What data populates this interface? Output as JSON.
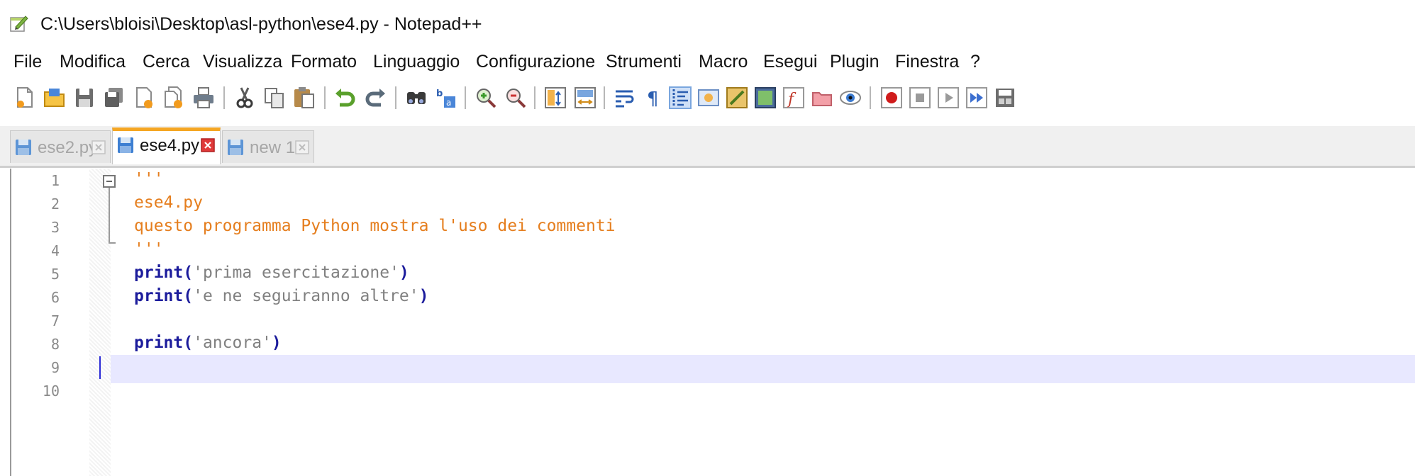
{
  "window": {
    "title": "C:\\Users\\bloisi\\Desktop\\asl-python\\ese4.py - Notepad++"
  },
  "menu": [
    "File",
    "Modifica",
    "Cerca",
    "Visualizza",
    "Formato",
    "Linguaggio",
    "Configurazione",
    "Strumenti",
    "Macro",
    "Esegui",
    "Plugin",
    "Finestra",
    "?"
  ],
  "toolbar": {
    "icons": [
      "new-file-icon",
      "open-file-icon",
      "save-icon",
      "save-all-icon",
      "close-icon",
      "close-all-icon",
      "print-icon",
      "cut-icon",
      "copy-icon",
      "paste-icon",
      "undo-icon",
      "redo-icon",
      "find-icon",
      "replace-icon",
      "zoom-in-icon",
      "zoom-out-icon",
      "sync-vertical-icon",
      "sync-horizontal-icon",
      "word-wrap-icon",
      "show-all-characters-icon",
      "indent-guide-icon",
      "user-language-icon",
      "document-map-icon",
      "function-list-icon",
      "folder-as-workspace-icon",
      "monitoring-icon",
      "macro-record-icon",
      "macro-stop-icon",
      "macro-play-icon",
      "macro-play-multiple-icon",
      "macro-save-icon"
    ]
  },
  "tabs": [
    {
      "label": "ese2.py",
      "active": false
    },
    {
      "label": "ese4.py",
      "active": true
    },
    {
      "label": "new 1",
      "active": false
    }
  ],
  "editor": {
    "line_numbers": [
      "1",
      "2",
      "3",
      "4",
      "5",
      "6",
      "7",
      "8",
      "9",
      "10"
    ],
    "current_line": 9,
    "lines": [
      {
        "parts": [
          {
            "text": "'''",
            "cls": "cmt"
          }
        ]
      },
      {
        "parts": [
          {
            "text": "ese4.py",
            "cls": "cmt"
          }
        ]
      },
      {
        "parts": [
          {
            "text": "questo programma Python mostra l'uso dei commenti",
            "cls": "cmt"
          }
        ]
      },
      {
        "parts": [
          {
            "text": "'''",
            "cls": "cmt"
          }
        ]
      },
      {
        "parts": [
          {
            "text": "print",
            "cls": "kw"
          },
          {
            "text": "(",
            "cls": "kw"
          },
          {
            "text": "'prima esercitazione'",
            "cls": "str"
          },
          {
            "text": ")",
            "cls": "kw"
          }
        ]
      },
      {
        "parts": [
          {
            "text": "print",
            "cls": "kw"
          },
          {
            "text": "(",
            "cls": "kw"
          },
          {
            "text": "'e ne seguiranno altre'",
            "cls": "str"
          },
          {
            "text": ")",
            "cls": "kw"
          }
        ]
      },
      {
        "parts": []
      },
      {
        "parts": [
          {
            "text": "print",
            "cls": "kw"
          },
          {
            "text": "(",
            "cls": "kw"
          },
          {
            "text": "'ancora'",
            "cls": "str"
          },
          {
            "text": ")",
            "cls": "kw"
          }
        ]
      },
      {
        "parts": []
      },
      {
        "parts": []
      }
    ]
  },
  "colors": {
    "keyword": "#1c1c9c",
    "string": "#808080",
    "comment": "#e57e1e",
    "current_line_bg": "#e8e8ff",
    "active_tab_accent": "#f5a623"
  }
}
